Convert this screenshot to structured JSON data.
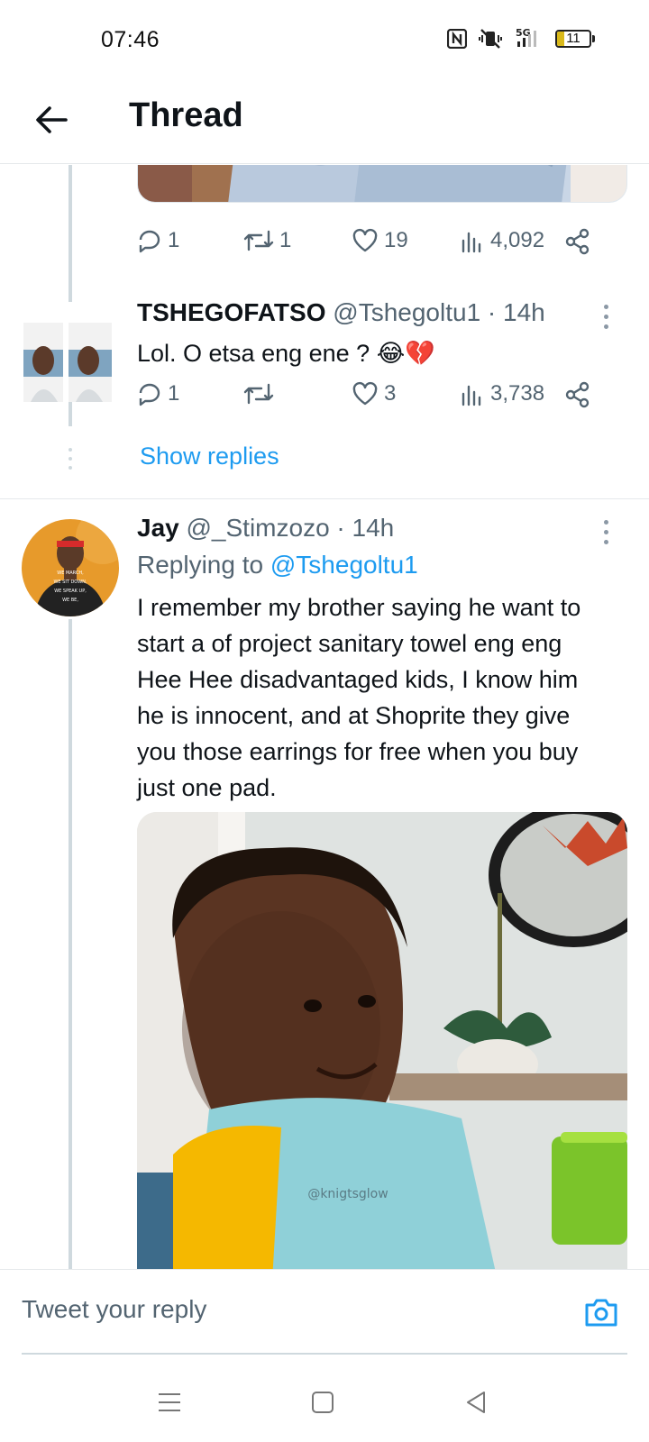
{
  "status_bar": {
    "time": "07:46",
    "battery": "11",
    "network": "5G",
    "icons": [
      "nfc-icon",
      "vibrate-off-icon",
      "signal-icon",
      "battery-icon"
    ]
  },
  "header": {
    "title": "Thread",
    "back_icon": "arrow-left-icon"
  },
  "previous_tweet": {
    "stats": {
      "replies": "1",
      "retweets": "1",
      "likes": "19",
      "views": "4,092"
    }
  },
  "tweet1": {
    "name": "TSHEGOFATSO",
    "handle": "@Tshegoltu1",
    "time": "· 14h",
    "text": "Lol. O etsa eng ene ? 😂💔",
    "stats": {
      "replies": "1",
      "retweets": "",
      "likes": "3",
      "views": "3,738"
    },
    "show_replies": "Show replies"
  },
  "tweet2": {
    "name": "Jay",
    "handle": "@_Stimzozo",
    "time": "· 14h",
    "replying_prefix": "Replying to",
    "replying_handle": "@Tshegoltu1",
    "text_lines": [
      "I remember my brother saying he want to",
      "start a of project sanitary towel eng eng",
      "Hee Hee disadvantaged kids, I know him",
      "he is innocent, and at Shoprite they give",
      "you those earrings for free when you buy",
      "just one pad."
    ],
    "media_watermark": "@knigtsglow",
    "avatar_shirt_text": [
      "WE MARCH,",
      "WE SIT DOWN,",
      "WE SPEAK UP,",
      "WE BE,"
    ]
  },
  "reply_bar": {
    "placeholder": "Tweet your reply",
    "camera_icon": "camera-icon"
  },
  "nav_bar": {
    "icons": [
      "menu-icon",
      "home-square-icon",
      "back-triangle-icon"
    ]
  },
  "colors": {
    "accent": "#1d9bf0",
    "text": "#0f1419",
    "muted": "#536471",
    "thread_line": "#cfd9de"
  }
}
